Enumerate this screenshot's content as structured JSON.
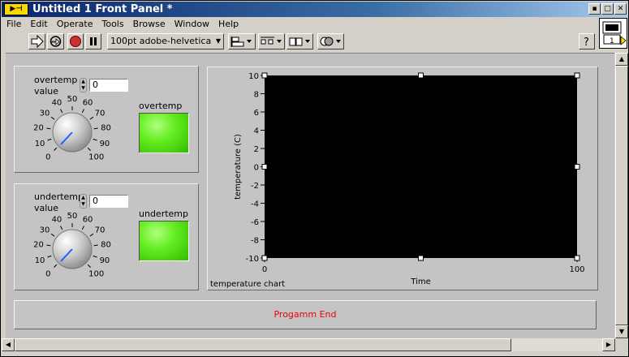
{
  "window": {
    "title": "Untitled 1 Front Panel *"
  },
  "menu": [
    "File",
    "Edit",
    "Operate",
    "Tools",
    "Browse",
    "Window",
    "Help"
  ],
  "toolbar": {
    "font": "100pt adobe-helvetica"
  },
  "vi_icon": {
    "label": "1"
  },
  "overtemp": {
    "knob_label": "overtemp value",
    "knob_label_1": "overtemp",
    "knob_label_2": "value",
    "value": "0",
    "led_label": "overtemp"
  },
  "undertemp": {
    "knob_label": "undertemp value",
    "knob_label_1": "undertemp",
    "knob_label_2": "value",
    "value": "0",
    "led_label": "undertemp"
  },
  "knob_scale": [
    "0",
    "10",
    "20",
    "30",
    "40",
    "50",
    "60",
    "70",
    "80",
    "90",
    "100"
  ],
  "chart_data": {
    "type": "line",
    "title": "temperature chart",
    "xlabel": "Time",
    "ylabel": "temperature (C)",
    "xlim": [
      0,
      100
    ],
    "ylim": [
      -10,
      10
    ],
    "x_ticks": [
      "0",
      "100"
    ],
    "y_ticks": [
      "10",
      "8",
      "6",
      "4",
      "2",
      "0",
      "-2",
      "-4",
      "-6",
      "-8",
      "-10"
    ],
    "series": [],
    "background": "#000000"
  },
  "end_button": {
    "label": "Progamm End"
  },
  "colors": {
    "led_on": "#66ee22",
    "end_text": "#ee0000",
    "plot_bg": "#000000"
  }
}
